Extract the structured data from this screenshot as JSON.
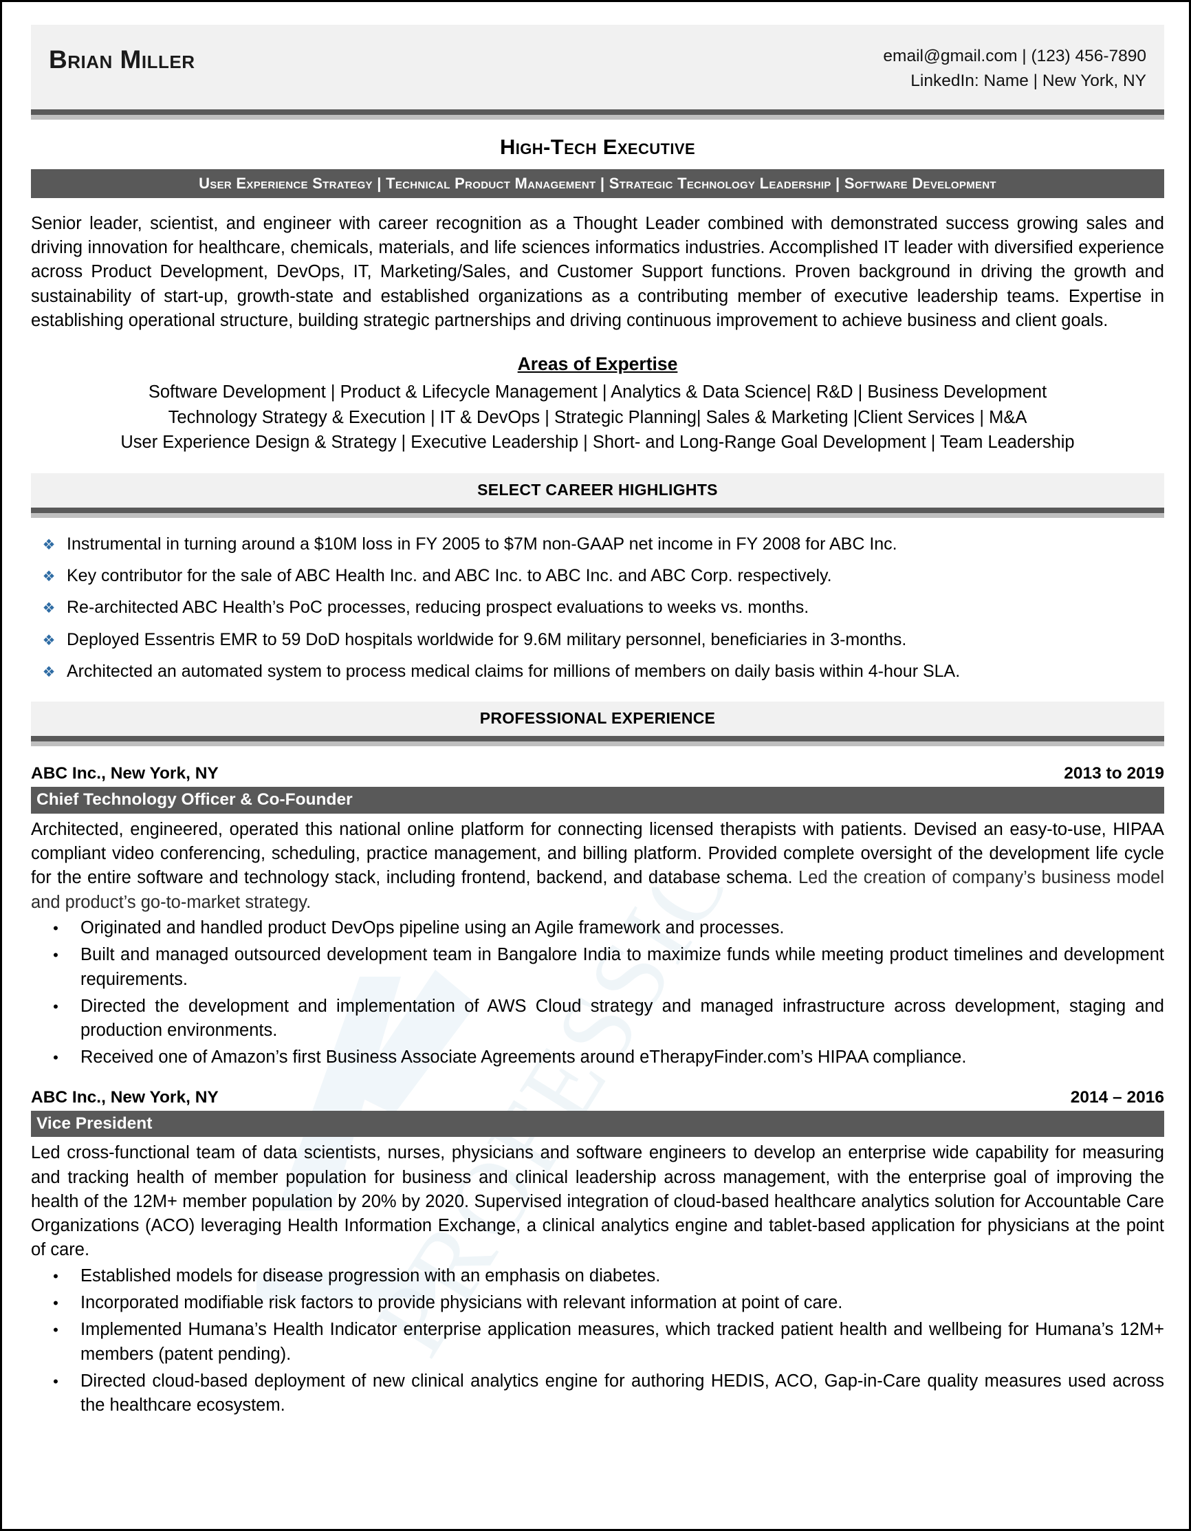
{
  "colors": {
    "band_light": "#f1f1f1",
    "bar_dark": "#595959",
    "rule_light": "#bfbfbf",
    "bullet_blue": "#2e6ca4"
  },
  "header": {
    "name": "Brian Miller",
    "contact_line1": "email@gmail.com | (123) 456-7890",
    "contact_line2": "LinkedIn: Name | New York, NY"
  },
  "title": {
    "headline": "High-Tech Executive",
    "specialties": "User Experience Strategy | Technical Product Management | Strategic Technology Leadership | Software Development"
  },
  "summary": {
    "text": "Senior leader, scientist, and engineer with career recognition as a Thought Leader combined with demonstrated success growing sales and driving innovation for healthcare, chemicals, materials, and life sciences informatics industries. Accomplished IT leader with diversified experience across Product Development, DevOps, IT, Marketing/Sales, and Customer Support functions. Proven background in driving the growth and sustainability of start-up, growth-state and established organizations as a contributing member of executive leadership teams. Expertise in establishing operational structure, building strategic partnerships and driving continuous improvement to achieve business and client goals."
  },
  "areas_of_expertise": {
    "title": "Areas of Expertise",
    "lines": [
      "Software Development | Product & Lifecycle Management | Analytics & Data Science| R&D | Business Development",
      "Technology Strategy & Execution | IT & DevOps | Strategic Planning| Sales & Marketing |Client Services | M&A",
      "User Experience Design & Strategy | Executive Leadership | Short- and Long-Range Goal Development | Team Leadership"
    ]
  },
  "highlights": {
    "heading": "SELECT CAREER HIGHLIGHTS",
    "bullet_glyph": "❖",
    "items": [
      "Instrumental in turning around a $10M loss in FY 2005 to $7M non-GAAP net income in FY 2008 for ABC Inc.",
      "Key contributor for the sale of ABC Health Inc. and ABC Inc. to ABC Inc. and ABC Corp. respectively.",
      "Re-architected ABC Health’s PoC processes, reducing prospect evaluations to weeks vs. months.",
      "Deployed Essentris EMR to 59 DoD hospitals worldwide for 9.6M military personnel, beneficiaries in 3-months.",
      "Architected an automated system to process medical claims for millions of members on daily basis within 4-hour SLA."
    ]
  },
  "experience": {
    "heading": "PROFESSIONAL EXPERIENCE",
    "bullet_glyph": "•",
    "jobs": [
      {
        "company": "ABC Inc., New York, NY",
        "dates": "2013 to 2019",
        "position": "Chief Technology Officer & Co-Founder",
        "description_main": "Architected, engineered, operated this national online platform for connecting licensed therapists with patients. Devised an easy-to-use, HIPAA compliant video conferencing, scheduling, practice management, and billing platform. Provided complete oversight of the development life cycle for the entire software and technology stack, including frontend, backend, and database schema.",
        "description_tail": " Led the creation of company’s business model and product’s go-to-market strategy.",
        "duties": [
          "Originated and handled product DevOps pipeline using an Agile framework and processes.",
          "Built and managed outsourced development team in Bangalore India to maximize funds while meeting product timelines and development requirements.",
          "Directed the development and implementation of AWS Cloud strategy and managed infrastructure across development, staging and production environments.",
          "Received one of Amazon’s first Business Associate Agreements around eTherapyFinder.com’s HIPAA compliance."
        ]
      },
      {
        "company": "ABC Inc., New York, NY",
        "dates": "2014 – 2016",
        "position": "Vice President",
        "description_main": "Led cross-functional team of data scientists, nurses, physicians and software engineers to develop an enterprise wide capability for measuring and tracking health of member population for business and clinical leadership across management, with the enterprise goal of improving the health of the 12M+ member population by 20% by 2020. Supervised integration of cloud-based healthcare analytics solution for Accountable Care Organizations (ACO) leveraging Health Information Exchange, a clinical analytics engine and tablet-based application for physicians at the point of care.",
        "description_tail": "",
        "duties": [
          "Established models for disease progression with an emphasis on diabetes.",
          "Incorporated modifiable risk factors to provide physicians with relevant information at point of care.",
          "Implemented Humana’s Health Indicator enterprise application measures, which tracked patient health and wellbeing for Humana’s 12M+ members (patent pending).",
          "Directed cloud-based deployment of new clinical analytics engine for authoring HEDIS, ACO, Gap-in-Care quality measures used across the healthcare ecosystem."
        ]
      }
    ]
  }
}
